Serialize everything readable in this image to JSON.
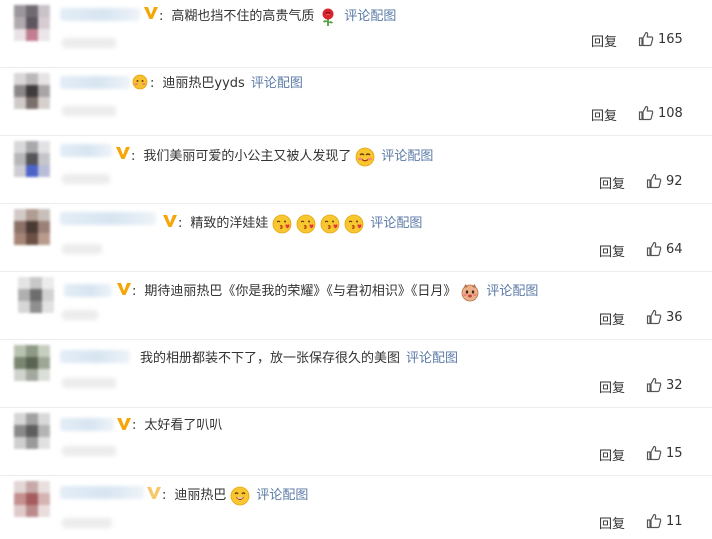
{
  "comments": [
    {
      "text": "高糊也挡不住的高贵气质",
      "emojis": [
        "rose-icon"
      ],
      "link": "评论配图",
      "reply": "回复",
      "likes": "165"
    },
    {
      "text": "迪丽热巴yyds",
      "emojis": [],
      "link": "评论配图",
      "reply": "回复",
      "likes": "108"
    },
    {
      "text": "我们美丽可爱的小公主又被人发现了",
      "emojis": [
        "blush-emoji-icon"
      ],
      "link": "评论配图",
      "reply": "回复",
      "likes": "92"
    },
    {
      "text": "精致的洋娃娃",
      "emojis": [
        "kiss-emoji-icon",
        "kiss-emoji-icon",
        "kiss-emoji-icon",
        "kiss-emoji-icon"
      ],
      "link": "评论配图",
      "reply": "回复",
      "likes": "64"
    },
    {
      "text": "期待迪丽热巴《你是我的荣耀》《与君初相识》《日月》",
      "emojis": [
        "shy-doge-emoji-icon"
      ],
      "link": "评论配图",
      "reply": "回复",
      "likes": "36"
    },
    {
      "text": "我的相册都装不下了，放一张保存很久的美图",
      "emojis": [],
      "link": "评论配图",
      "reply": "回复",
      "likes": "32"
    },
    {
      "text": "太好看了叭叭",
      "emojis": [],
      "link": "",
      "reply": "回复",
      "likes": "15"
    },
    {
      "text": "迪丽热巴",
      "emojis": [
        "grin-emoji-icon"
      ],
      "link": "评论配图",
      "reply": "回复",
      "likes": "11"
    }
  ],
  "colors": {
    "link": "#5b7aa6",
    "badge": "#f6a60a",
    "text": "#333333",
    "divider": "#ededed"
  }
}
